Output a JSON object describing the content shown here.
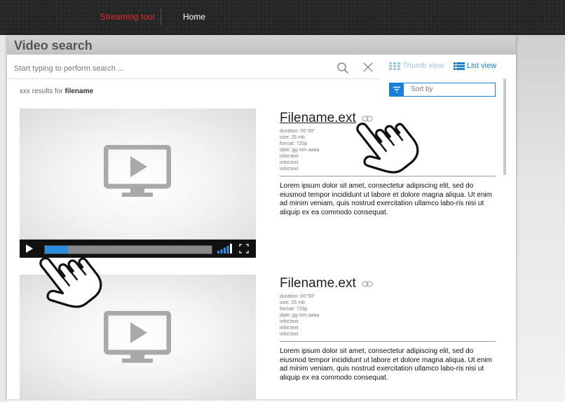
{
  "nav": {
    "brand": "Streaming tool",
    "home": "Home"
  },
  "page": {
    "title": "Video search"
  },
  "search": {
    "placeholder": "Start typing to perform search ..."
  },
  "views": {
    "thumb_label": "Thumb view",
    "list_label": "List view",
    "active": "list"
  },
  "results": {
    "prefix": "xxx results for ",
    "query": "filename"
  },
  "sort": {
    "label": "Sort by"
  },
  "player": {
    "progress": 0.14
  },
  "colors": {
    "accent": "#1a7fd6",
    "brand": "#e3262d",
    "topbar": "#262626"
  },
  "items": [
    {
      "filename": "Filename.ext",
      "meta": [
        "duration: 00':50''",
        "size: 25 mb",
        "format: 720p",
        "date: gg mm aaaa",
        "infot:text",
        "infot:text",
        "infot:text"
      ],
      "description": "Lorem ipsum dolor sit amet, consectetur adipiscing elit, sed do eiusmod tempor incididunt ut labore et dolore magna aliqua. Ut enim ad minim veniam, quis nostrud exercitation ullamco labo-ris nisi ut aliquip ex ea commodo consequat."
    },
    {
      "filename": "Filename.ext",
      "meta": [
        "duration: 00':50''",
        "size: 25 mb",
        "format: 720p",
        "date: gg mm aaaa",
        "infot:text",
        "infot:text",
        "infot:text"
      ],
      "description": "Lorem ipsum dolor sit amet, consectetur adipiscing elit, sed do eiusmod tempor incididunt ut labore et dolore magna aliqua. Ut enim ad minim veniam, quis nostrud exercitation ullamco labo-ris nisi ut aliquip ex ea commodo consequat."
    }
  ]
}
